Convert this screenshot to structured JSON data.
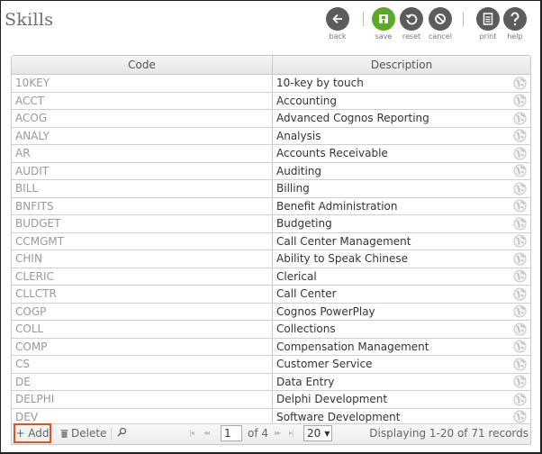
{
  "page": {
    "title": "Skills"
  },
  "toolbar": {
    "back": "back",
    "save": "save",
    "reset": "reset",
    "cancel": "cancel",
    "print": "print",
    "help": "help",
    "save_color": "#5aaa28"
  },
  "table": {
    "columns": [
      "Code",
      "Description"
    ],
    "rows": [
      {
        "code": "10KEY",
        "description": "10-key by touch"
      },
      {
        "code": "ACCT",
        "description": "Accounting"
      },
      {
        "code": "ACOG",
        "description": "Advanced Cognos Reporting"
      },
      {
        "code": "ANALY",
        "description": "Analysis"
      },
      {
        "code": "AR",
        "description": "Accounts Receivable"
      },
      {
        "code": "AUDIT",
        "description": "Auditing"
      },
      {
        "code": "BILL",
        "description": "Billing"
      },
      {
        "code": "BNFITS",
        "description": "Benefit Administration"
      },
      {
        "code": "BUDGET",
        "description": "Budgeting"
      },
      {
        "code": "CCMGMT",
        "description": "Call Center Management"
      },
      {
        "code": "CHIN",
        "description": "Ability to Speak Chinese"
      },
      {
        "code": "CLERIC",
        "description": "Clerical"
      },
      {
        "code": "CLLCTR",
        "description": "Call Center"
      },
      {
        "code": "COGP",
        "description": "Cognos PowerPlay"
      },
      {
        "code": "COLL",
        "description": "Collections"
      },
      {
        "code": "COMP",
        "description": "Compensation  Management"
      },
      {
        "code": "CS",
        "description": "Customer Service"
      },
      {
        "code": "DE",
        "description": "Data Entry"
      },
      {
        "code": "DELPHI",
        "description": "Delphi Development"
      },
      {
        "code": "DEV",
        "description": "Software Development"
      }
    ],
    "row_icon": "globe-icon"
  },
  "pager": {
    "add_label": "+ Add",
    "delete_label": "Delete",
    "current_page": "1",
    "of_pages": "of 4",
    "page_size": "20",
    "records_text": "Displaying 1-20 of 71 records"
  }
}
